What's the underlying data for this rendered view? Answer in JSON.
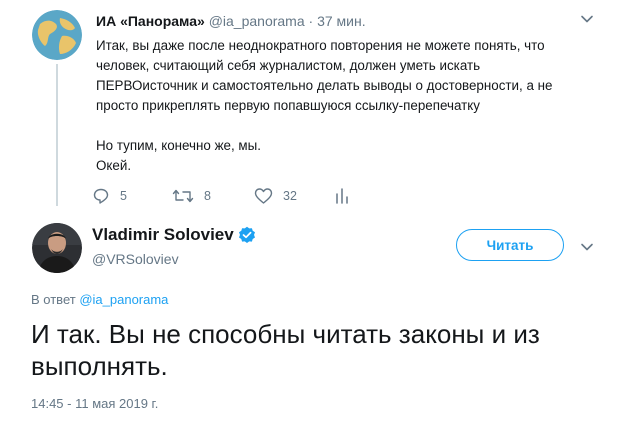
{
  "tweet1": {
    "author_name": "ИА «Панорама»",
    "handle": "@ia_panorama",
    "separator": "·",
    "time": "37 мин.",
    "text_lines": [
      "Итак, вы даже после неоднократного повторения не можете понять, что",
      "человек, считающий себя журналистом, должен уметь искать",
      "ПЕРВОисточник и самостоятельно делать выводы о достоверности, а не",
      "просто прикреплять первую попавшуюся ссылку-перепечатку",
      "Но тупим, конечно же, мы.",
      "Окей."
    ],
    "replies": "5",
    "retweets": "8",
    "likes": "32",
    "icons": [
      "globe-avatar",
      "chevron-down-icon",
      "reply-icon",
      "retweet-icon",
      "heart-icon",
      "analytics-icon"
    ]
  },
  "tweet2": {
    "author_name": "Vladimir Soloviev",
    "handle": "@VRSoloviev",
    "follow_label": "Читать",
    "reply_prefix": "В ответ",
    "reply_mention": "@ia_panorama",
    "text": "И так. Вы не способны читать законы и из выполнять.",
    "timestamp": "14:45 - 11 мая 2019 г.",
    "icons": [
      "verified-badge-icon",
      "chevron-down-icon"
    ]
  },
  "colors": {
    "accent": "#1da1f2",
    "secondary_text": "#657786",
    "primary_text": "#14171a"
  }
}
